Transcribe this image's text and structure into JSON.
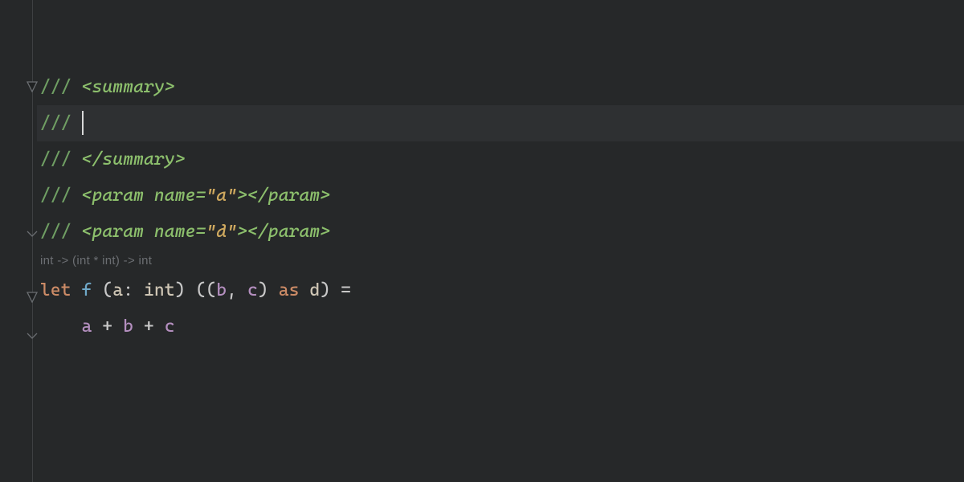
{
  "doc": {
    "slash": "///",
    "summary_open": "<summary>",
    "summary_close": "</summary>",
    "param_open": "<param",
    "param_attr_name": "name",
    "param_a_val": "\"a\"",
    "param_d_val": "\"d\"",
    "param_close_end": "</param>",
    "gt": ">"
  },
  "inlay": {
    "signature": "int -> (int * int) -> int"
  },
  "code": {
    "let_kw": "let",
    "fn_name": "f",
    "param1_name": "a",
    "colon": ":",
    "param1_type": "int",
    "tuple_b": "b",
    "comma": ",",
    "tuple_c": "c",
    "as_kw": "as",
    "as_name": "d",
    "eq": "=",
    "body_a": "a",
    "plus": "+",
    "body_b": "b",
    "body_c": "c"
  }
}
